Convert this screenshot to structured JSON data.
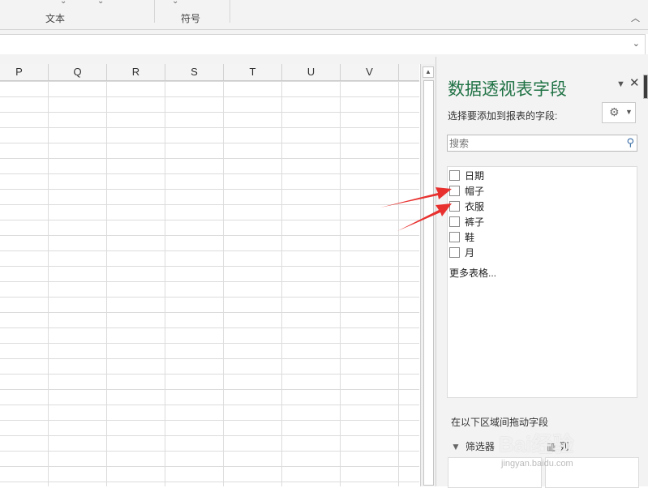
{
  "ribbon": {
    "group_text": "文本",
    "group_symbols": "符号",
    "collapse_icon": "chevron-up-icon"
  },
  "formula_bar": {
    "value": "",
    "dropdown_icon": "chevron-down-icon"
  },
  "sheet": {
    "columns": [
      "P",
      "Q",
      "R",
      "S",
      "T",
      "U",
      "V"
    ]
  },
  "pivot_pane": {
    "title": "数据透视表字段",
    "subtitle": "选择要添加到报表的字段:",
    "search_placeholder": "搜索",
    "fields": [
      {
        "label": "日期",
        "checked": false
      },
      {
        "label": "帽子",
        "checked": false
      },
      {
        "label": "衣服",
        "checked": false
      },
      {
        "label": "裤子",
        "checked": false
      },
      {
        "label": "鞋",
        "checked": false
      },
      {
        "label": "月",
        "checked": false
      }
    ],
    "more_tables": "更多表格...",
    "drag_label": "在以下区域间拖动字段",
    "filter_zone": "筛选器",
    "columns_zone": "列"
  },
  "annotations": {
    "arrow_color": "#e8312f"
  },
  "watermark": {
    "text": "Bai经验",
    "sub": "jingyan.baidu.com"
  }
}
